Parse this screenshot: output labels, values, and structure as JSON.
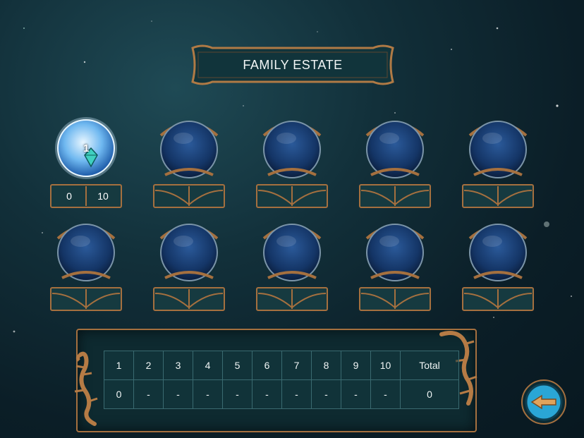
{
  "title": "FAMILY ESTATE",
  "orbs": [
    {
      "row": 1,
      "active": true,
      "count": "1",
      "left_value": "0",
      "right_value": "10",
      "icon": "crystal-gem-icon"
    },
    {
      "row": 1,
      "active": false
    },
    {
      "row": 1,
      "active": false
    },
    {
      "row": 1,
      "active": false
    },
    {
      "row": 1,
      "active": false
    },
    {
      "row": 2,
      "active": false
    },
    {
      "row": 2,
      "active": false
    },
    {
      "row": 2,
      "active": false
    },
    {
      "row": 2,
      "active": false
    },
    {
      "row": 2,
      "active": false
    }
  ],
  "score_table": {
    "headers": [
      "1",
      "2",
      "3",
      "4",
      "5",
      "6",
      "7",
      "8",
      "9",
      "10",
      "Total"
    ],
    "values": [
      "0",
      "-",
      "-",
      "-",
      "-",
      "-",
      "-",
      "-",
      "-",
      "-",
      "0"
    ]
  },
  "back_button": {
    "icon": "arrow-left-icon"
  },
  "colors": {
    "frame_bronze": "#a5703f",
    "orb_blue": "#1a3f7a",
    "active_orb": "#6fb8f0",
    "button_cyan": "#2aa6d6"
  }
}
